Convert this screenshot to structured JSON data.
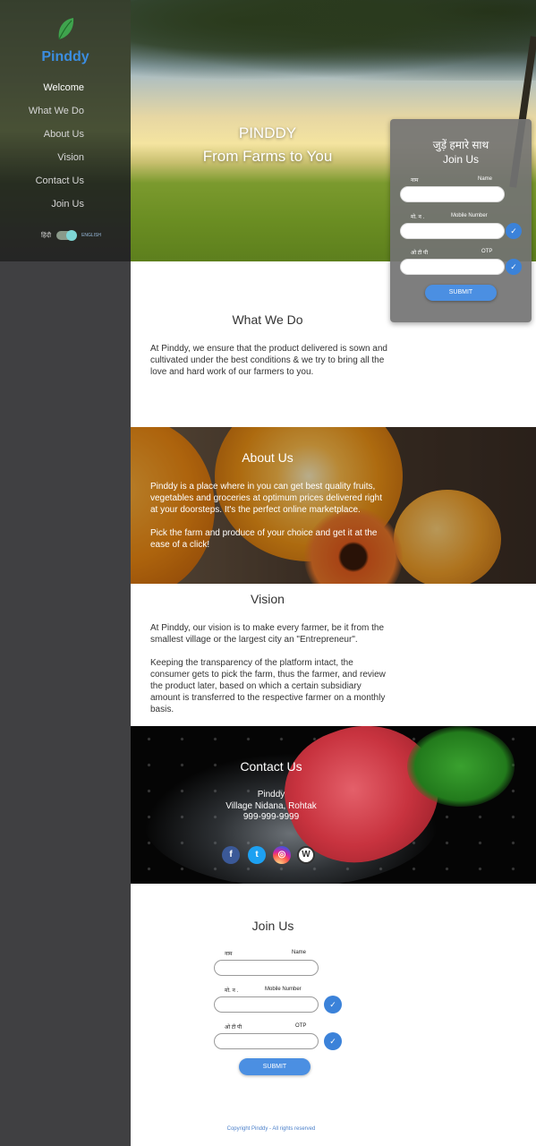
{
  "brand": {
    "name": "Pinddy",
    "logo_icon": "leaf-icon",
    "accent_color": "#3b8de0"
  },
  "sidebar": {
    "items": [
      {
        "label": "Welcome"
      },
      {
        "label": "What We Do"
      },
      {
        "label": "About Us"
      },
      {
        "label": "Vision"
      },
      {
        "label": "Contact Us"
      },
      {
        "label": "Join Us"
      }
    ],
    "language": {
      "hindi": "हिंदी",
      "english": "ENGLISH",
      "selected": "ENGLISH"
    }
  },
  "hero": {
    "title_line1": "PINDDY",
    "title_line2": "From Farms to You"
  },
  "join_card": {
    "title_hindi": "जुड़ें हमारे साथ",
    "title": "Join Us",
    "fields": [
      {
        "label_hi": "नाम",
        "label_en": "Name"
      },
      {
        "label_hi": "मो. न .",
        "label_en": "Mobile Number"
      },
      {
        "label_hi": "ओ टी पी",
        "label_en": "OTP"
      }
    ],
    "submit": "SUBMIT"
  },
  "what_we_do": {
    "title": "What We Do",
    "body": "At Pinddy, we ensure that the product delivered is sown and cultivated under the best conditions & we try to bring all the love and hard work of our farmers to you."
  },
  "about": {
    "title": "About Us",
    "para1": "Pinddy is a place where in you can get best quality fruits, vegetables and groceries at optimum prices delivered right at your doorsteps. It's the perfect online marketplace.",
    "para2": "Pick the farm and produce of your choice and get it at the ease of a click!"
  },
  "vision": {
    "title": "Vision",
    "para1": "At Pinddy, our vision is to make every farmer, be it from the smallest village or the largest city an \"Entrepreneur\".",
    "para2": "Keeping the transparency of the platform intact, the consumer gets to pick the farm, thus the farmer, and review the product later, based on which a certain subsidiary amount is transferred to the respective farmer on a monthly basis."
  },
  "contact": {
    "title": "Contact Us",
    "name": "Pinddy",
    "address": "Village Nidana, Rohtak",
    "phone": "999-999-9999",
    "social": [
      {
        "icon": "facebook-icon",
        "glyph": "f"
      },
      {
        "icon": "twitter-icon",
        "glyph": "t"
      },
      {
        "icon": "instagram-icon",
        "glyph": "◎"
      },
      {
        "icon": "wordpress-icon",
        "glyph": "W"
      }
    ]
  },
  "join_bottom": {
    "title": "Join Us",
    "fields": [
      {
        "label_hi": "नाम",
        "label_en": "Name"
      },
      {
        "label_hi": "मो. न .",
        "label_en": "Mobile Number"
      },
      {
        "label_hi": "ओ टी पी",
        "label_en": "OTP"
      }
    ],
    "submit": "SUBMIT"
  },
  "footer": {
    "copyright": "Copyright Pinddy - All rights reserved"
  }
}
